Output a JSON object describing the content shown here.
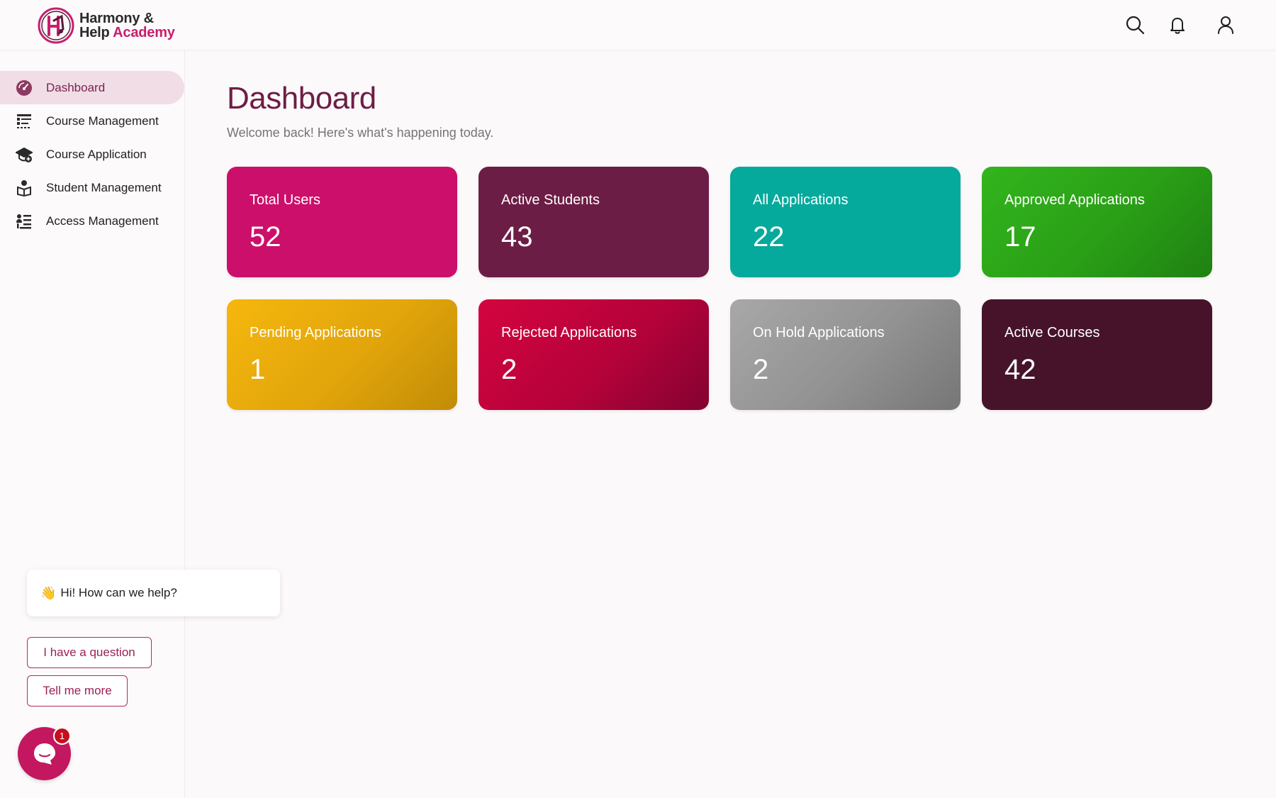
{
  "app": {
    "brand_line1": "Harmony &",
    "brand_line2_a": "Help",
    "brand_line2_b": "Academy"
  },
  "header": {
    "icons": [
      "search-icon",
      "bell-icon",
      "user-icon"
    ]
  },
  "sidebar": {
    "items": [
      {
        "label": "Dashboard",
        "icon": "dashboard-gauge-icon",
        "active": true
      },
      {
        "label": "Course Management",
        "icon": "course-list-icon",
        "active": false
      },
      {
        "label": "Course Application",
        "icon": "graduation-cap-add-icon",
        "active": false
      },
      {
        "label": "Student Management",
        "icon": "student-reading-icon",
        "active": false
      },
      {
        "label": "Access Management",
        "icon": "user-access-list-icon",
        "active": false
      }
    ]
  },
  "main": {
    "title": "Dashboard",
    "subtitle": "Welcome back! Here's what's happening today.",
    "cards": [
      {
        "label": "Total Users",
        "value": "52"
      },
      {
        "label": "Active Students",
        "value": "43"
      },
      {
        "label": "All Applications",
        "value": "22"
      },
      {
        "label": "Approved Applications",
        "value": "17"
      },
      {
        "label": "Pending Applications",
        "value": "1"
      },
      {
        "label": "Rejected Applications",
        "value": "2"
      },
      {
        "label": "On Hold Applications",
        "value": "2"
      },
      {
        "label": "Active Courses",
        "value": "42"
      }
    ]
  },
  "chat": {
    "greeting": "Hi! How can we help?",
    "wave_emoji": "👋",
    "options": [
      "I have a question",
      "Tell me more"
    ],
    "badge_count": "1"
  },
  "colors": {
    "brand": "#c71e6e",
    "title": "#6e1d45",
    "active_nav_bg": "#f1dde6"
  }
}
